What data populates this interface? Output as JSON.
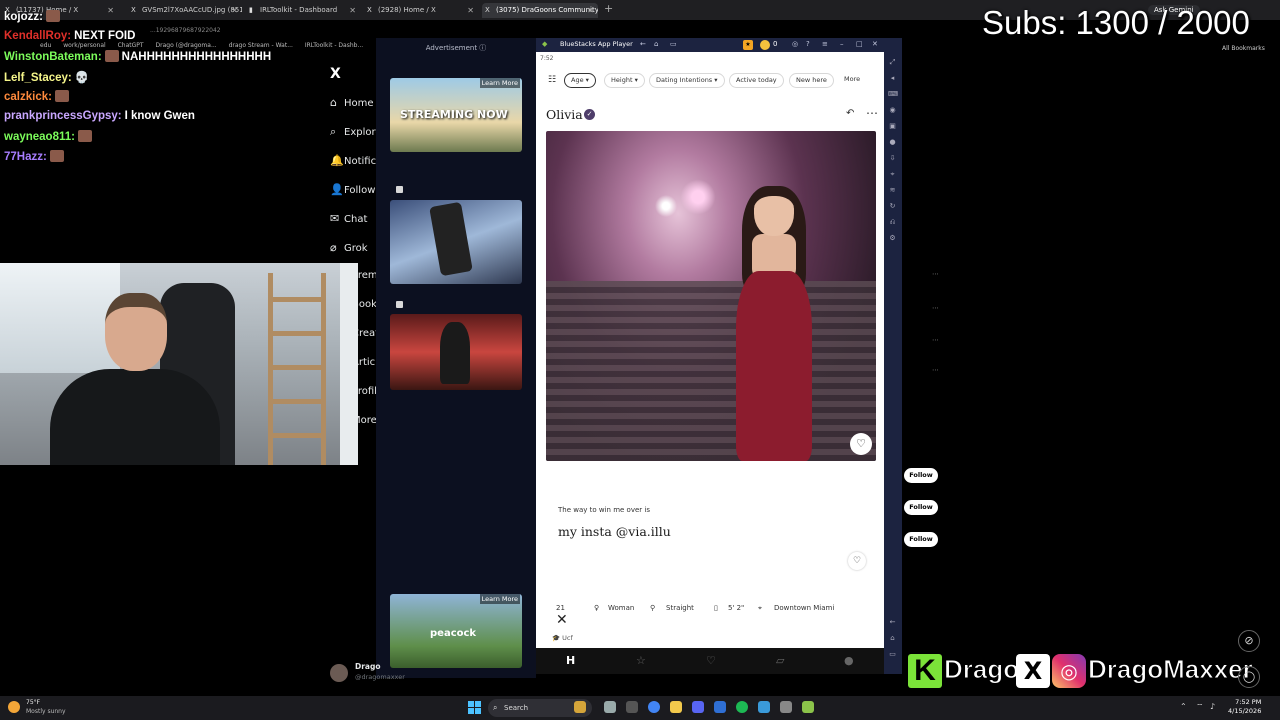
{
  "browser": {
    "tabs": [
      {
        "label": "(11737) Home / X",
        "icon": "X"
      },
      {
        "label": "GVSm2l7XoAACcUD.jpg (851×...",
        "icon": "X"
      },
      {
        "label": "IRLToolkit - Dashboard",
        "icon": "▮"
      },
      {
        "label": "(2928) Home / X",
        "icon": "X"
      },
      {
        "label": "(3075) DraGoons Community /",
        "icon": "X"
      }
    ],
    "url_fragment": "...19296879687922042",
    "bookmarks": [
      "edu",
      "work/personal",
      "ChatGPT",
      "Drago (@dragoma...",
      "drago Stream - Wat...",
      "IRLToolkit - Dashb..."
    ],
    "all_bookmarks": "All Bookmarks",
    "ask_gemini": "Ask Gemini"
  },
  "chat": [
    {
      "user": "kojozz:",
      "color": "#ffffff",
      "message": "",
      "emote": true
    },
    {
      "user": "KendallRoy:",
      "color": "#e0302a",
      "message": "NEXT FOID",
      "emote": false
    },
    {
      "user": "WinstonBateman:",
      "color": "#7cfc5b",
      "message": "NAHHHHHHHHHHHHHHHH",
      "emote": true
    },
    {
      "user": "Lelf_Stacey:",
      "color": "#f5f58a",
      "message": "💀",
      "emote": false
    },
    {
      "user": "calzkick:",
      "color": "#ff8a3d",
      "message": "",
      "emote": true
    },
    {
      "user": "prankprincessGypsy:",
      "color": "#c9a7ff",
      "message": "I know Gwen",
      "emote": false
    },
    {
      "user": "wayneao811:",
      "color": "#7cfc5b",
      "message": "",
      "emote": true
    },
    {
      "user": "77Hazz:",
      "color": "#a77dff",
      "message": "",
      "emote": true
    }
  ],
  "subs_goal": "Subs: 1300 / 2000",
  "x_sidebar": {
    "logo": "X",
    "items": [
      {
        "icon": "⌂",
        "label": "Home"
      },
      {
        "icon": "⌕",
        "label": "Explore"
      },
      {
        "icon": "🔔",
        "label": "Notifications"
      },
      {
        "icon": "👤",
        "label": "Follow"
      },
      {
        "icon": "✉",
        "label": "Chat"
      },
      {
        "icon": "⌀",
        "label": "Grok"
      }
    ],
    "more_items": [
      "Premium",
      "Bookmarks",
      "Creator Studio",
      "Articles",
      "Profile",
      "More"
    ],
    "profile_name": "Drago",
    "profile_handle": "@dragomaxxer"
  },
  "ads": {
    "label": "Advertisement ⓘ",
    "learn_more": "Learn More",
    "streaming_now": "STREAMING NOW",
    "peacock": "peacock"
  },
  "bluestacks": {
    "title": "BlueStacks App Player",
    "coins": "0",
    "time": "7:52",
    "filters": [
      "Age",
      "Height",
      "Dating Intentions",
      "Active today",
      "New here",
      "More"
    ],
    "profile": {
      "name": "Olivia",
      "prompt_question": "The way to win me over is",
      "prompt_answer": "my insta @via.illu",
      "vitals": [
        "21",
        "Woman",
        "Straight",
        "5' 2\"",
        "Downtown Miami"
      ],
      "education": "Ucf"
    }
  },
  "right_panel": {
    "follow_label": "Follow"
  },
  "social": {
    "k_letter": "K",
    "name1": "Drago",
    "name2": "DragoMaxxer"
  },
  "taskbar": {
    "temperature": "75°F",
    "weather_desc": "Mostly sunny",
    "search_placeholder": "Search",
    "time": "7:52 PM",
    "date": "4/15/2026"
  },
  "colors": {
    "bluestacks_title": "#1c2340",
    "ad_column": "#0c1020",
    "dress": "#8c1c2e",
    "kick_green": "#7be339"
  }
}
